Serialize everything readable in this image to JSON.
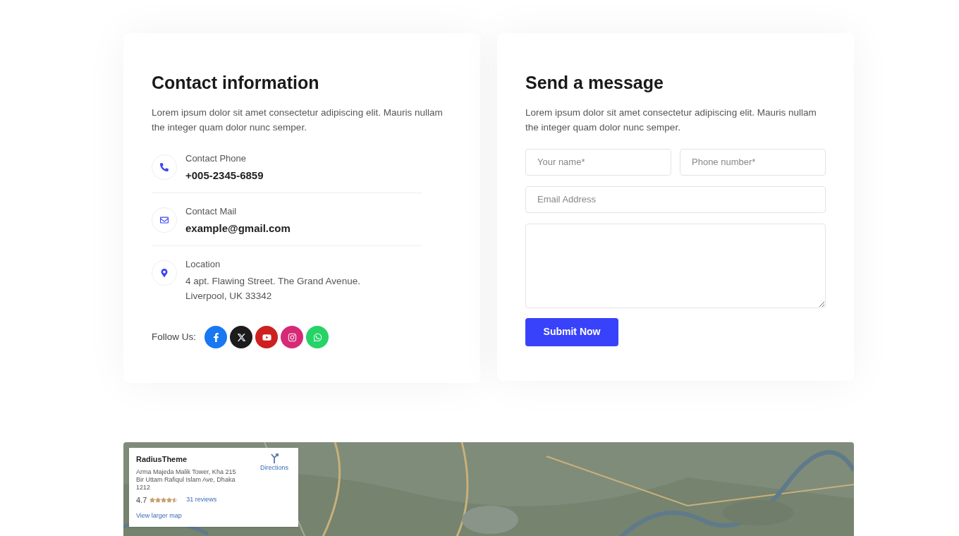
{
  "contact": {
    "title": "Contact information",
    "text": "Lorem ipsum dolor sit amet consectetur adipiscing elit. Mauris nullam the integer quam dolor nunc semper.",
    "items": [
      {
        "kind": "phone",
        "label": "Contact Phone",
        "value": "+005-2345-6859"
      },
      {
        "kind": "mail",
        "label": "Contact Mail",
        "value": "example@gmail.com"
      },
      {
        "kind": "location",
        "label": "Location",
        "value": "4 apt. Flawing Street. The Grand Avenue. Liverpool, UK 33342"
      }
    ],
    "follow_label": "Follow Us:",
    "socials": [
      {
        "kind": "facebook",
        "color": "#1877f2"
      },
      {
        "kind": "x",
        "color": "#1c1c1c"
      },
      {
        "kind": "youtube",
        "color": "#cd201f"
      },
      {
        "kind": "instagram",
        "color": "#d62976"
      },
      {
        "kind": "whatsapp",
        "color": "#25d366"
      }
    ]
  },
  "message": {
    "title": "Send a message",
    "text": "Lorem ipsum dolor sit amet consectetur adipiscing elit. Mauris nullam the integer quam dolor nunc semper.",
    "fields": [
      {
        "placeholder": "Your name*"
      },
      {
        "placeholder": "Phone number*"
      },
      {
        "placeholder": "Email Address"
      }
    ],
    "submit": "Submit Now"
  },
  "map": {
    "kind": "picture",
    "place": {
      "name": "RadiusTheme",
      "address": "Arma Majeda Malik Tower, Kha 215 Bir Uttam Rafiqul Islam Ave, Dhaka 1212",
      "rating": "4.7",
      "stars": 4.5,
      "reviews": "31 reviews",
      "directions": "Directions",
      "larger_map": "View larger map"
    }
  }
}
